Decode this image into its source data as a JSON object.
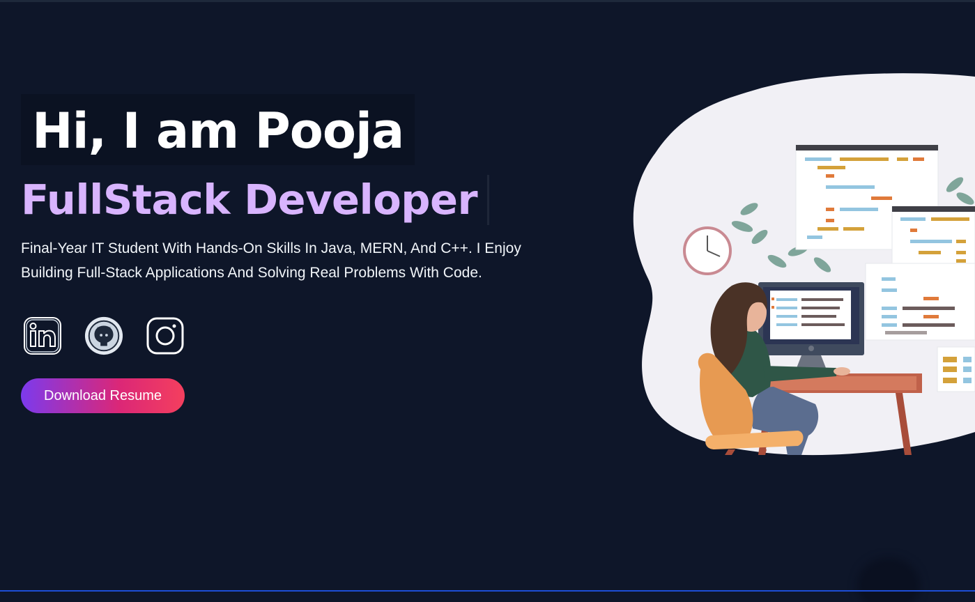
{
  "hero": {
    "greeting": "Hi, I am Pooja",
    "role": "FullStack Developer",
    "intro": "Final-Year IT Student With Hands-On Skills In Java, MERN, And C++. I Enjoy Building Full-Stack Applications And Solving Real Problems With Code.",
    "download_label": "Download Resume"
  },
  "socials": [
    {
      "name": "LinkedIn",
      "icon": "linkedin-icon"
    },
    {
      "name": "GitHub",
      "icon": "github-icon"
    },
    {
      "name": "Instagram",
      "icon": "instagram-icon"
    }
  ],
  "colors": {
    "background": "#0e1629",
    "accent_purple": "#d8b4fe",
    "button_gradient_start": "#7c3aed",
    "button_gradient_end": "#f43f5e"
  }
}
